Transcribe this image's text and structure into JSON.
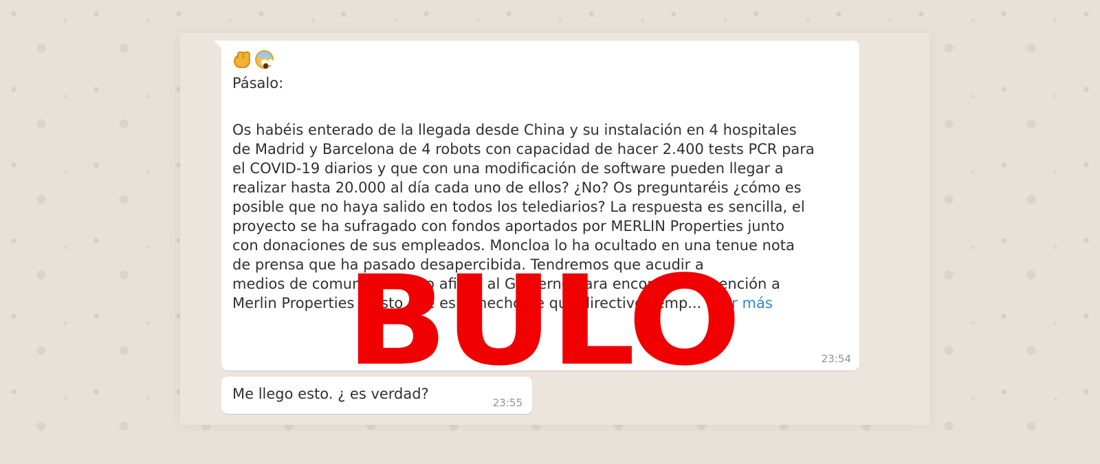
{
  "messages": [
    {
      "icons": [
        "fist-emoji-icon",
        "face-screaming-in-fear-emoji-icon"
      ],
      "intro": "Pásalo:",
      "body": "Os habéis enterado de la llegada desde China y su instalación en 4 hospitales\nde Madrid y Barcelona de 4 robots con capacidad de hacer 2.400 tests PCR para\nel COVID-19 diarios y que con una modificación de software pueden llegar a\nrealizar hasta 20.000 al día cada uno de ellos? ¿No? Os preguntaréis ¿cómo es\nposible que no haya salido en todos los telediarios? La respuesta es sencilla, el\nproyecto se ha sufragado con fondos aportados por MERLIN Properties junto\ncon donaciones de sus empleados. Moncloa lo ha ocultado en una tenue nota\nde prensa que ha pasado desapercibida. Tendremos que acudir a\nmedios de comunicación no afines al Gobierno para encontrar la mención a\nMerlin Properties y esto que es el hecho de que directivos emp...",
      "read_more": "Leer más",
      "time": "23:54"
    },
    {
      "text": "Me llego esto. ¿ es verdad?",
      "time": "23:55"
    }
  ],
  "stamp": "BULO",
  "colors": {
    "stamp": "#f00000",
    "link": "#2d86d4",
    "bubble": "#ffffff",
    "background": "#e7e1da"
  }
}
